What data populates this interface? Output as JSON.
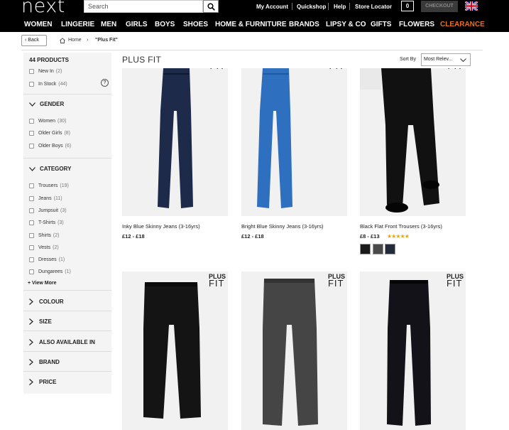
{
  "header": {
    "logo": "next",
    "search_placeholder": "Search",
    "links": [
      "My Account",
      "Quickshop",
      "Help",
      "Store Locator"
    ],
    "bag_count": "0",
    "checkout_label": "CHECKOUT"
  },
  "nav": [
    "WOMEN",
    "LINGERIE",
    "MEN",
    "GIRLS",
    "BOYS",
    "SHOES",
    "HOME & FURNITURE",
    "BRANDS",
    "LIPSY & CO",
    "GIFTS",
    "FLOWERS",
    "CLEARANCE"
  ],
  "breadcrumb": {
    "back": "Back",
    "home": "Home",
    "current": "\"Plus Fit\""
  },
  "sidebar": {
    "count": "44 PRODUCTS",
    "availability": [
      {
        "label": "New In",
        "count": "(2)"
      },
      {
        "label": "In Stock",
        "count": "(44)"
      }
    ],
    "gender_title": "GENDER",
    "gender": [
      {
        "label": "Women",
        "count": "(30)"
      },
      {
        "label": "Older Girls",
        "count": "(8)"
      },
      {
        "label": "Older Boys",
        "count": "(6)"
      }
    ],
    "category_title": "CATEGORY",
    "category": [
      {
        "label": "Trousers",
        "count": "(19)"
      },
      {
        "label": "Jeans",
        "count": "(11)"
      },
      {
        "label": "Jumpsuit",
        "count": "(3)"
      },
      {
        "label": "T-Shirts",
        "count": "(3)"
      },
      {
        "label": "Shirts",
        "count": "(2)"
      },
      {
        "label": "Vests",
        "count": "(2)"
      },
      {
        "label": "Dresses",
        "count": "(1)"
      },
      {
        "label": "Dungarees",
        "count": "(1)"
      }
    ],
    "view_more": "+ View More",
    "collapsed": [
      "COLOUR",
      "SIZE",
      "ALSO AVAILABLE IN",
      "BRAND",
      "PRICE"
    ]
  },
  "main": {
    "title": "PLUS FIT",
    "sort_label": "Sort By",
    "sort_value": "Most Relev...",
    "badge_top": "PLUS",
    "badge_bottom": "FIT"
  },
  "products": [
    {
      "title": "Inky Blue Skinny Jeans (3-16yrs)",
      "price": "£12 - £18",
      "color": "#1e2a4a"
    },
    {
      "title": "Bright Blue Skinny Jeans (3-16yrs)",
      "price": "£12 - £18",
      "color": "#2f6fc0"
    },
    {
      "title": "Black Flat Front Trousers (3-16yrs)",
      "price": "£8 - £13",
      "color": "#111111",
      "rating": "★★★★★",
      "swatches": [
        "#1a1a1a",
        "#4a4a4a",
        "#232a3a"
      ]
    },
    {
      "color": "#141414"
    },
    {
      "color": "#454545"
    },
    {
      "color": "#121218"
    }
  ]
}
